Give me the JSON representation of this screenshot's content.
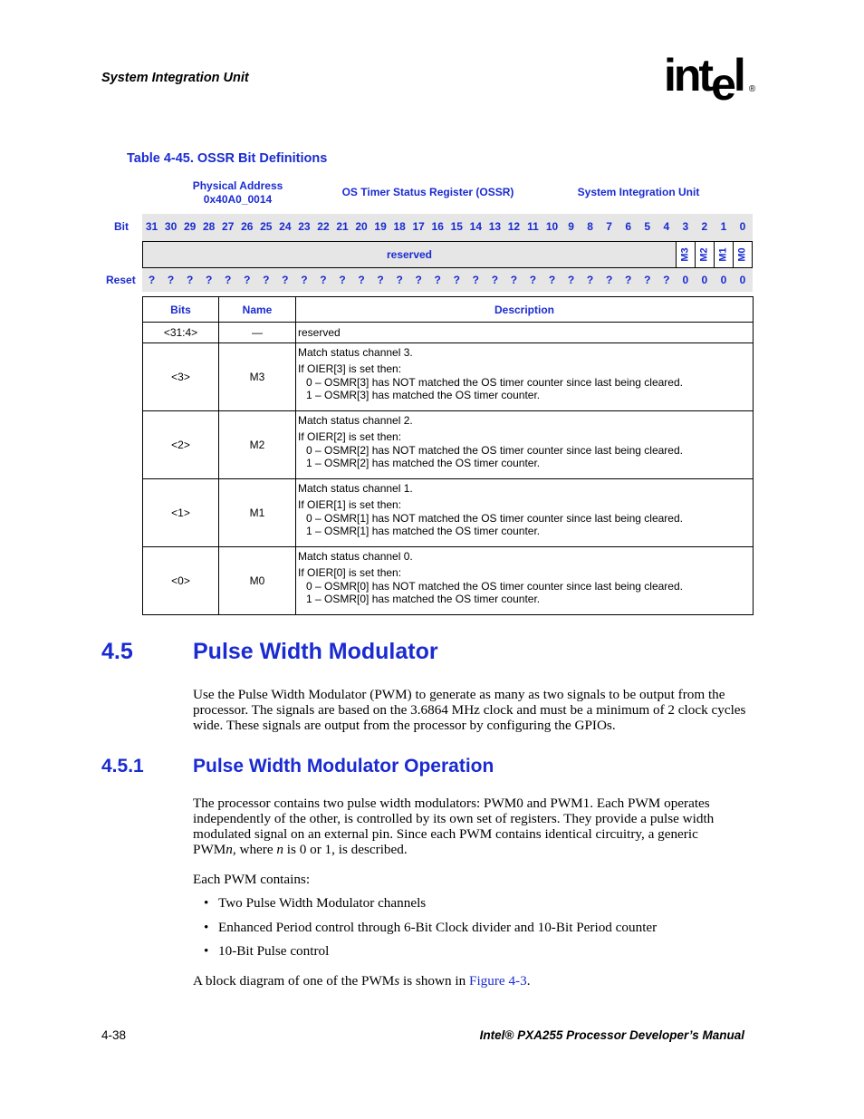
{
  "header": {
    "section_title": "System Integration Unit",
    "logo": {
      "text_left": "int",
      "text_e": "e",
      "text_l": "l",
      "registered": "®"
    }
  },
  "table_caption": "Table 4-45. OSSR Bit Definitions",
  "register": {
    "address_label": "Physical Address",
    "address_value": "0x40A0_0014",
    "name": "OS Timer Status Register (OSSR)",
    "unit": "System Integration Unit",
    "bit_label": "Bit",
    "reset_label": "Reset",
    "bits": [
      "31",
      "30",
      "29",
      "28",
      "27",
      "26",
      "25",
      "24",
      "23",
      "22",
      "21",
      "20",
      "19",
      "18",
      "17",
      "16",
      "15",
      "14",
      "13",
      "12",
      "11",
      "10",
      "9",
      "8",
      "7",
      "6",
      "5",
      "4",
      "3",
      "2",
      "1",
      "0"
    ],
    "fields": {
      "reserved": "reserved",
      "m3": "M3",
      "m2": "M2",
      "m1": "M1",
      "m0": "M0"
    },
    "reset_values": [
      "?",
      "?",
      "?",
      "?",
      "?",
      "?",
      "?",
      "?",
      "?",
      "?",
      "?",
      "?",
      "?",
      "?",
      "?",
      "?",
      "?",
      "?",
      "?",
      "?",
      "?",
      "?",
      "?",
      "?",
      "?",
      "?",
      "?",
      "?",
      "0",
      "0",
      "0",
      "0"
    ]
  },
  "desc_table": {
    "headers": {
      "bits": "Bits",
      "name": "Name",
      "description": "Description"
    },
    "rows": [
      {
        "bits": "<31:4>",
        "name": "—",
        "line1": "reserved"
      },
      {
        "bits": "<3>",
        "name": "M3",
        "line1": "Match status channel 3.",
        "line2": "If OIER[3] is set then:",
        "opt0": "0 –  OSMR[3] has NOT matched the OS timer counter since last being cleared.",
        "opt1": "1 –  OSMR[3] has matched the OS timer counter."
      },
      {
        "bits": "<2>",
        "name": "M2",
        "line1": "Match status channel 2.",
        "line2": "If OIER[2] is set then:",
        "opt0": "0 –  OSMR[2] has NOT matched the OS timer counter since last being cleared.",
        "opt1": "1 –  OSMR[2] has matched the OS timer counter."
      },
      {
        "bits": "<1>",
        "name": "M1",
        "line1": "Match status channel 1.",
        "line2": "If OIER[1] is set then:",
        "opt0": "0 –  OSMR[1] has NOT matched the OS timer counter since last being cleared.",
        "opt1": "1 –  OSMR[1] has matched the OS timer counter."
      },
      {
        "bits": "<0>",
        "name": "M0",
        "line1": "Match status channel 0.",
        "line2": "If OIER[0] is set then:",
        "opt0": "0 –  OSMR[0] has NOT matched the OS timer counter since last being cleared.",
        "opt1": "1 –  OSMR[0] has matched the OS timer counter."
      }
    ]
  },
  "section_4_5": {
    "number": "4.5",
    "title": "Pulse Width Modulator",
    "paragraph": "Use the Pulse Width Modulator (PWM) to generate as many as two signals to be output from the processor. The signals are based on the 3.6864 MHz clock and must be a minimum of 2 clock cycles wide. These signals are output from the processor by configuring the GPIOs."
  },
  "section_4_5_1": {
    "number": "4.5.1",
    "title": "Pulse Width Modulator Operation",
    "para1_a": "The processor contains two pulse width modulators: PWM0 and PWM1. Each PWM operates independently of the other, is controlled by its own set of registers. They provide a pulse width modulated signal on an external pin. Since each PWM contains identical circuitry, a generic PWM",
    "para1_n": "n,",
    "para1_b": " where ",
    "para1_n2": "n",
    "para1_c": " is 0 or 1, is described.",
    "para2": "Each PWM contains:",
    "bullets": [
      "Two Pulse Width Modulator channels",
      "Enhanced Period control through 6-Bit Clock divider and 10-Bit Period counter",
      "10-Bit Pulse control"
    ],
    "para3_a": "A block diagram of one of the PWM",
    "para3_s": "s",
    "para3_b": " is shown in ",
    "para3_link": "Figure 4-3",
    "para3_c": "."
  },
  "footer": {
    "page_number": "4-38",
    "manual_title": "Intel® PXA255 Processor Developer’s Manual"
  }
}
